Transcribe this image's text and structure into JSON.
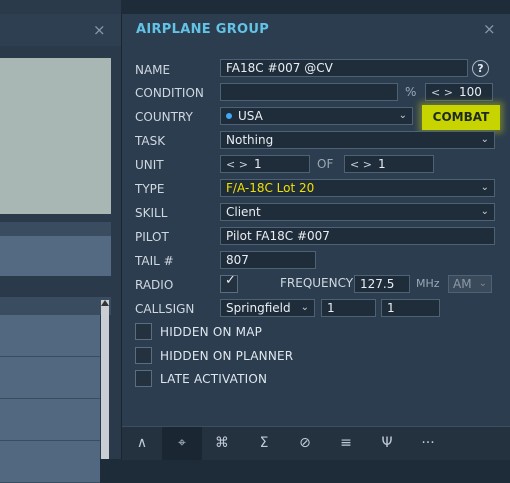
{
  "left_panel": {
    "close_glyph": "×"
  },
  "panel": {
    "title": "AIRPLANE GROUP",
    "close_glyph": "×",
    "help_glyph": "?"
  },
  "form": {
    "name": {
      "label": "NAME",
      "value": "FA18C #007 @CV"
    },
    "condition": {
      "label": "CONDITION",
      "value": "",
      "unit": "%",
      "percent": "100"
    },
    "country": {
      "label": "COUNTRY",
      "value": "USA",
      "dot_color": "#3fa9f5"
    },
    "combat_button": "COMBAT",
    "task": {
      "label": "TASK",
      "value": "Nothing"
    },
    "unit": {
      "label": "UNIT",
      "current": "1",
      "of_label": "OF",
      "total": "1"
    },
    "type": {
      "label": "TYPE",
      "value": "F/A-18C Lot 20",
      "value_color": "#f0e000"
    },
    "skill": {
      "label": "SKILL",
      "value": "Client"
    },
    "pilot": {
      "label": "PILOT",
      "value": "Pilot FA18C #007"
    },
    "tail": {
      "label": "TAIL #",
      "value": "807"
    },
    "radio": {
      "label": "RADIO",
      "checked": true,
      "frequency_label": "FREQUENCY",
      "frequency": "127.5",
      "unit": "MHz",
      "modulation": "AM"
    },
    "callsign": {
      "label": "CALLSIGN",
      "name": "Springfield",
      "group": "1",
      "member": "1"
    },
    "checkboxes": [
      {
        "label": "HIDDEN ON MAP",
        "checked": false
      },
      {
        "label": "HIDDEN ON PLANNER",
        "checked": false
      },
      {
        "label": "LATE ACTIVATION",
        "checked": false
      }
    ]
  },
  "spinner_glyph": "< >",
  "toolbar": {
    "items": [
      {
        "icon": "route-icon",
        "glyph": "∧",
        "active": false
      },
      {
        "icon": "payload-icon",
        "glyph": "⌖",
        "active": true
      },
      {
        "icon": "triggered-actions-icon",
        "glyph": "⌘",
        "active": false
      },
      {
        "icon": "summary-icon",
        "glyph": "Σ",
        "active": false
      },
      {
        "icon": "failures-icon",
        "glyph": "⊘",
        "active": false
      },
      {
        "icon": "properties-icon",
        "glyph": "≡",
        "active": false
      },
      {
        "icon": "radio-presets-icon",
        "glyph": "Ψ",
        "active": false
      },
      {
        "icon": "more-icon",
        "glyph": "···",
        "active": false
      }
    ]
  }
}
